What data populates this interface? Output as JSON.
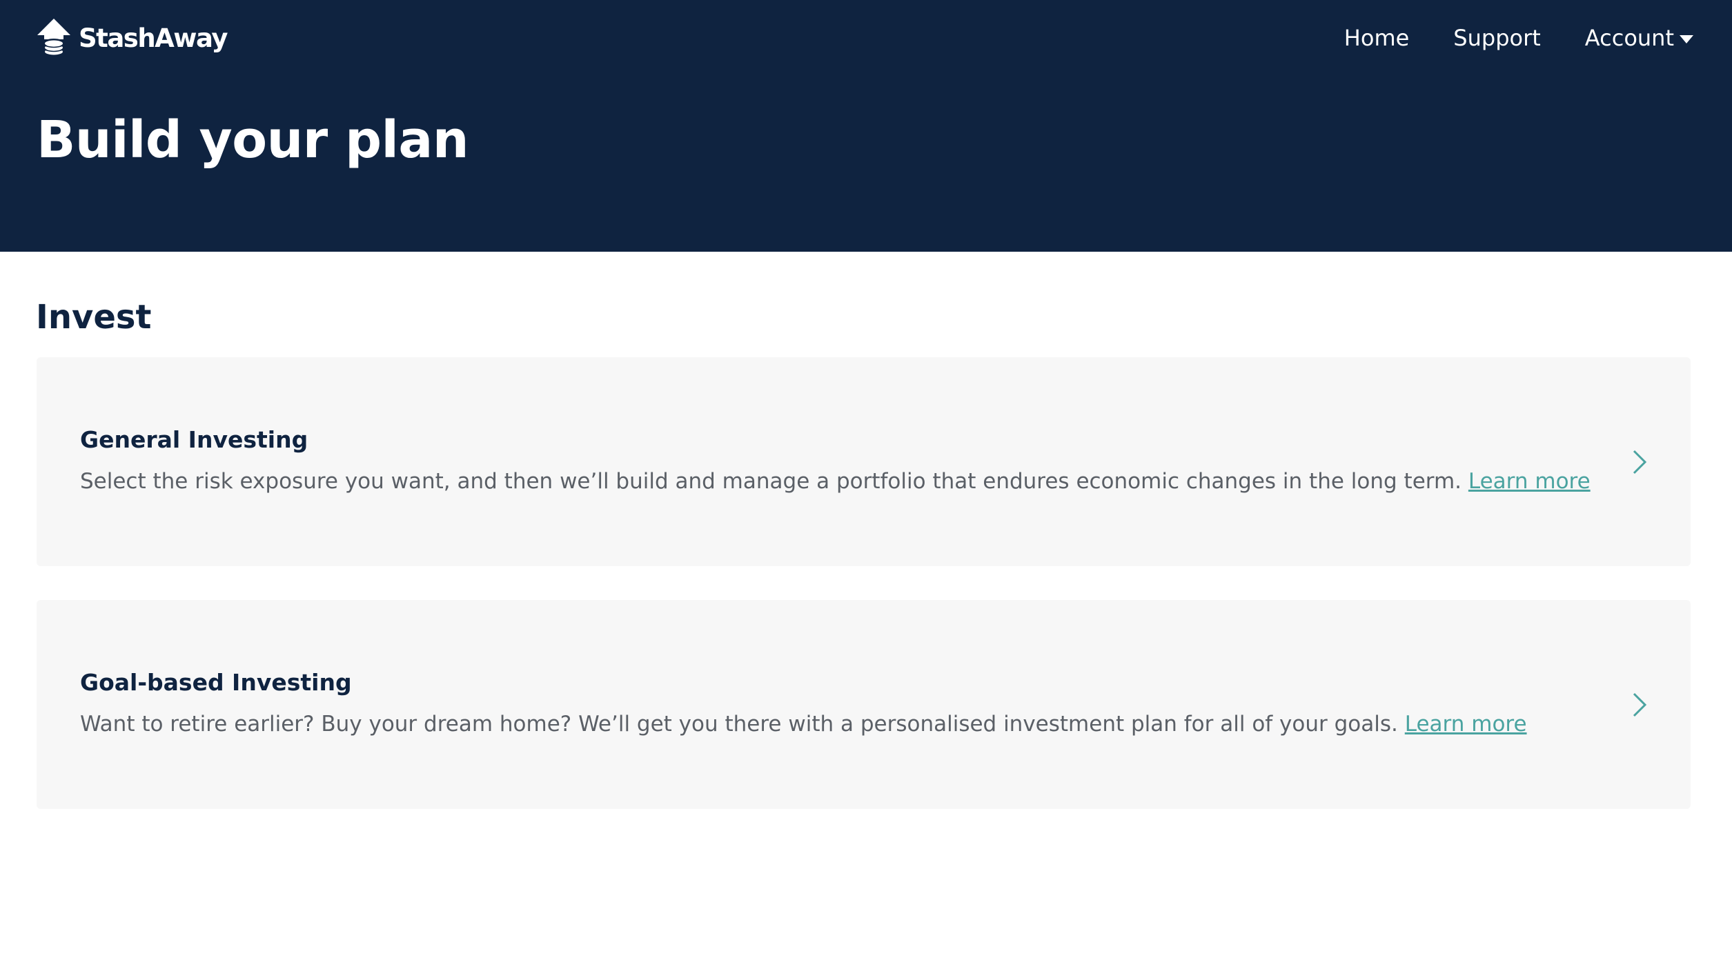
{
  "header": {
    "logo_text": "StashAway",
    "nav": {
      "home": "Home",
      "support": "Support",
      "account": "Account"
    },
    "title": "Build your plan"
  },
  "section": {
    "title": "Invest"
  },
  "cards": [
    {
      "title": "General Investing",
      "description": "Select the risk exposure you want, and then we’ll build and manage a portfolio that endures economic changes in the long term.",
      "link": "Learn more"
    },
    {
      "title": "Goal-based Investing",
      "description": "Want to retire earlier? Buy your dream home? We’ll get you there with a personalised investment plan for all of your goals.",
      "link": "Learn more"
    }
  ],
  "colors": {
    "header_bg": "#0f2340",
    "card_bg": "#f7f7f7",
    "link": "#4aa3a0",
    "heading": "#0f2340"
  },
  "icons": {
    "logo": "house-coin-stack-icon",
    "account_dropdown": "caret-down-icon",
    "card_arrow": "chevron-right-icon"
  }
}
